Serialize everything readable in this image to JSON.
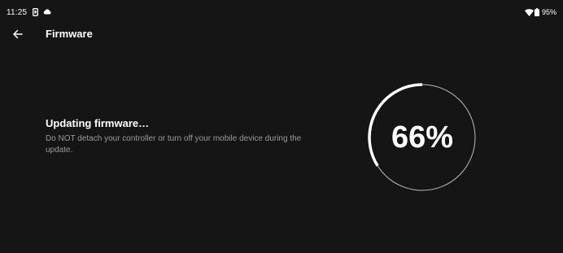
{
  "status_bar": {
    "time": "11:25",
    "battery": "95%"
  },
  "app_bar": {
    "title": "Firmware"
  },
  "message": {
    "title": "Updating firmware…",
    "body": "Do NOT detach your controller or turn off your mobile device during the update."
  },
  "progress": {
    "value": 0.66,
    "label": "66%"
  },
  "colors": {
    "background": "#151515",
    "ring_track": "#bdbdbd",
    "ring_progress": "#ffffff",
    "body_text": "#9a9a9a"
  },
  "icons": {
    "back": "arrow-left-icon",
    "notification_1": "device-icon",
    "notification_2": "cloud-icon",
    "wifi": "wifi-icon",
    "battery": "battery-icon"
  }
}
